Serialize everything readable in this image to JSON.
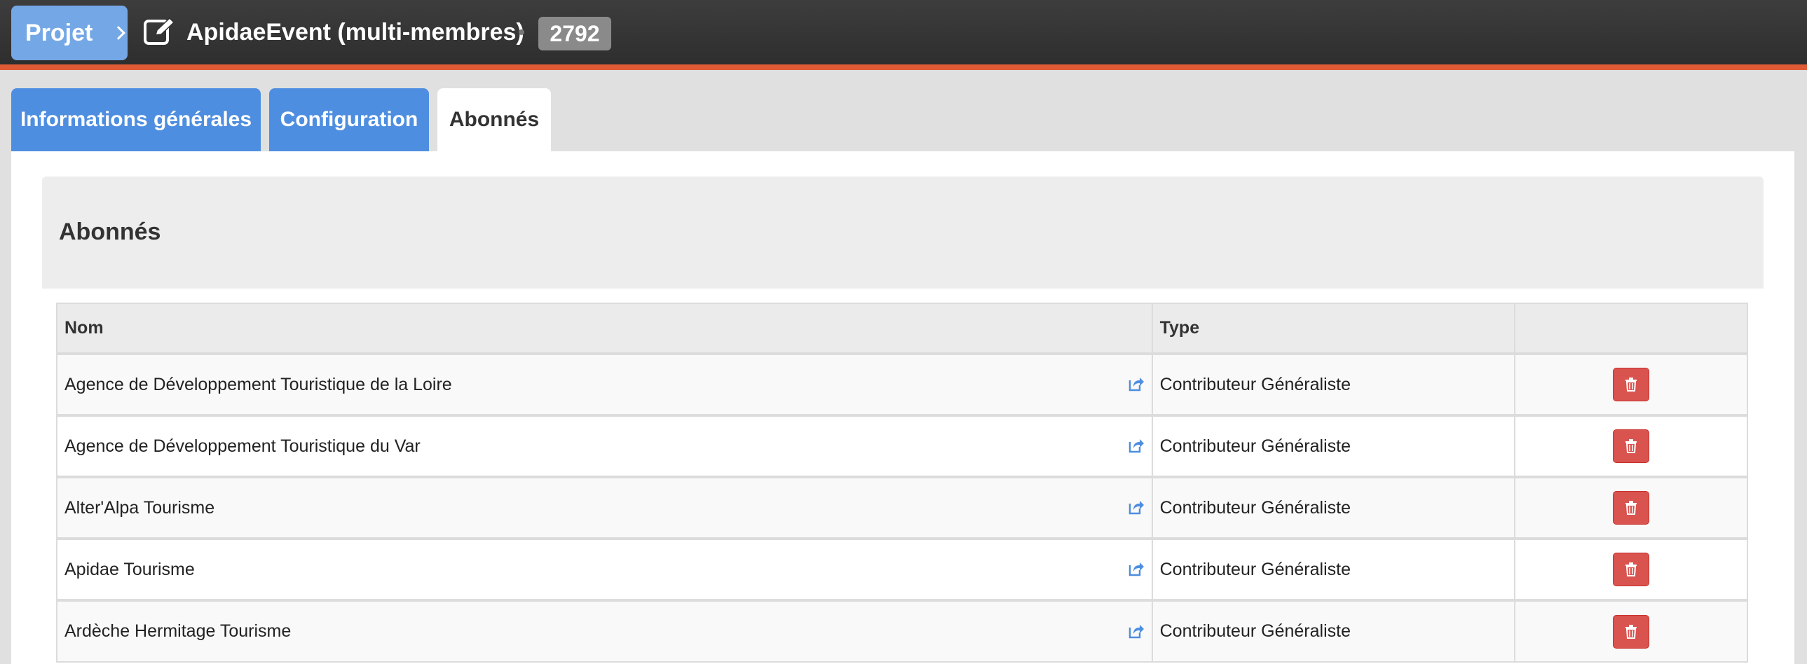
{
  "header": {
    "projet_label": "Projet",
    "title": "ApidaeEvent (multi-membres)",
    "project_id": "2792"
  },
  "tabs": [
    {
      "label": "Informations générales"
    },
    {
      "label": "Configuration"
    },
    {
      "label": "Abonnés"
    }
  ],
  "section": {
    "title": "Abonnés"
  },
  "table": {
    "columns": [
      "Nom",
      "Type",
      ""
    ],
    "rows": [
      {
        "nom": "Agence de Développement Touristique de la Loire",
        "type": "Contributeur Généraliste"
      },
      {
        "nom": "Agence de Développement Touristique du Var",
        "type": "Contributeur Généraliste"
      },
      {
        "nom": "Alter'Alpa Tourisme",
        "type": "Contributeur Généraliste"
      },
      {
        "nom": "Apidae Tourisme",
        "type": "Contributeur Généraliste"
      },
      {
        "nom": "Ardèche Hermitage Tourisme",
        "type": "Contributeur Généraliste"
      }
    ]
  },
  "icons": {
    "edit": "edit-icon",
    "external_link": "external-link-icon",
    "delete": "trash-icon"
  },
  "colors": {
    "accent_blue": "#4e8ee0",
    "topbar_stripe": "#e05a35",
    "danger": "#d9534f"
  }
}
